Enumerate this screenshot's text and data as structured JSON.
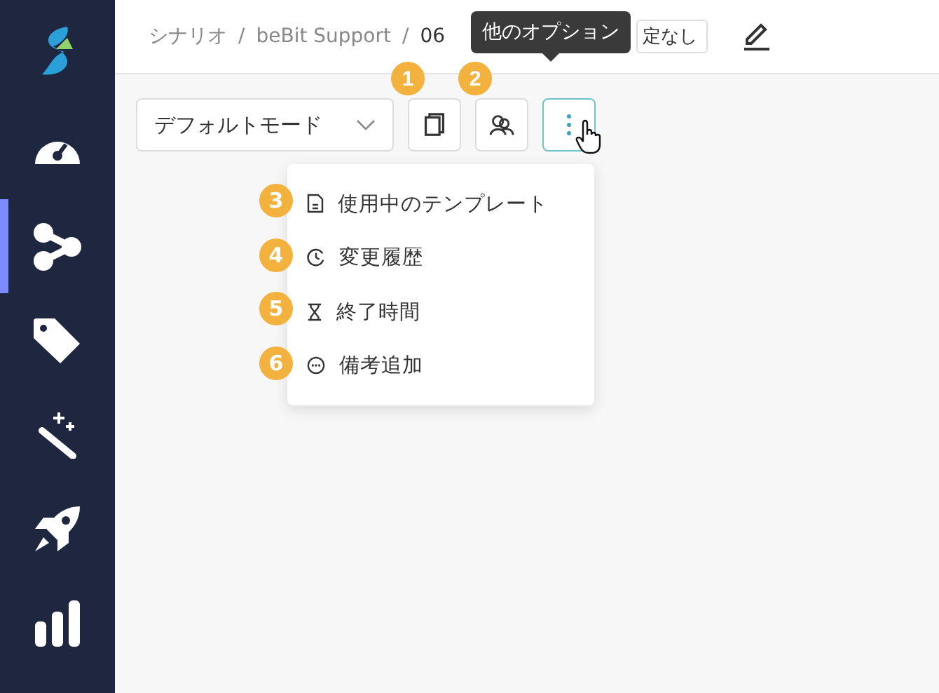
{
  "sidebar": {
    "items": [
      {
        "selected": false
      },
      {
        "selected": true
      },
      {
        "selected": false
      },
      {
        "selected": false
      },
      {
        "selected": false
      },
      {
        "selected": false
      }
    ]
  },
  "breadcrumb": [
    {
      "kind": "link",
      "text": "シナリオ"
    },
    {
      "kind": "separator",
      "text": "/"
    },
    {
      "kind": "link",
      "text": "beBit Support"
    },
    {
      "kind": "separator",
      "text": "/"
    },
    {
      "kind": "current",
      "text": "06"
    }
  ],
  "status_tag": "定なし",
  "tooltip": "他のオプション",
  "toolbar": {
    "mode_select": "デフォルトモード",
    "badges": [
      "1",
      "2"
    ]
  },
  "menu": {
    "items": [
      {
        "badge": "3",
        "label": "使用中のテンプレート"
      },
      {
        "badge": "4",
        "label": "変更履歴"
      },
      {
        "badge": "5",
        "label": "終了時間"
      },
      {
        "badge": "6",
        "label": "備考追加"
      }
    ]
  }
}
